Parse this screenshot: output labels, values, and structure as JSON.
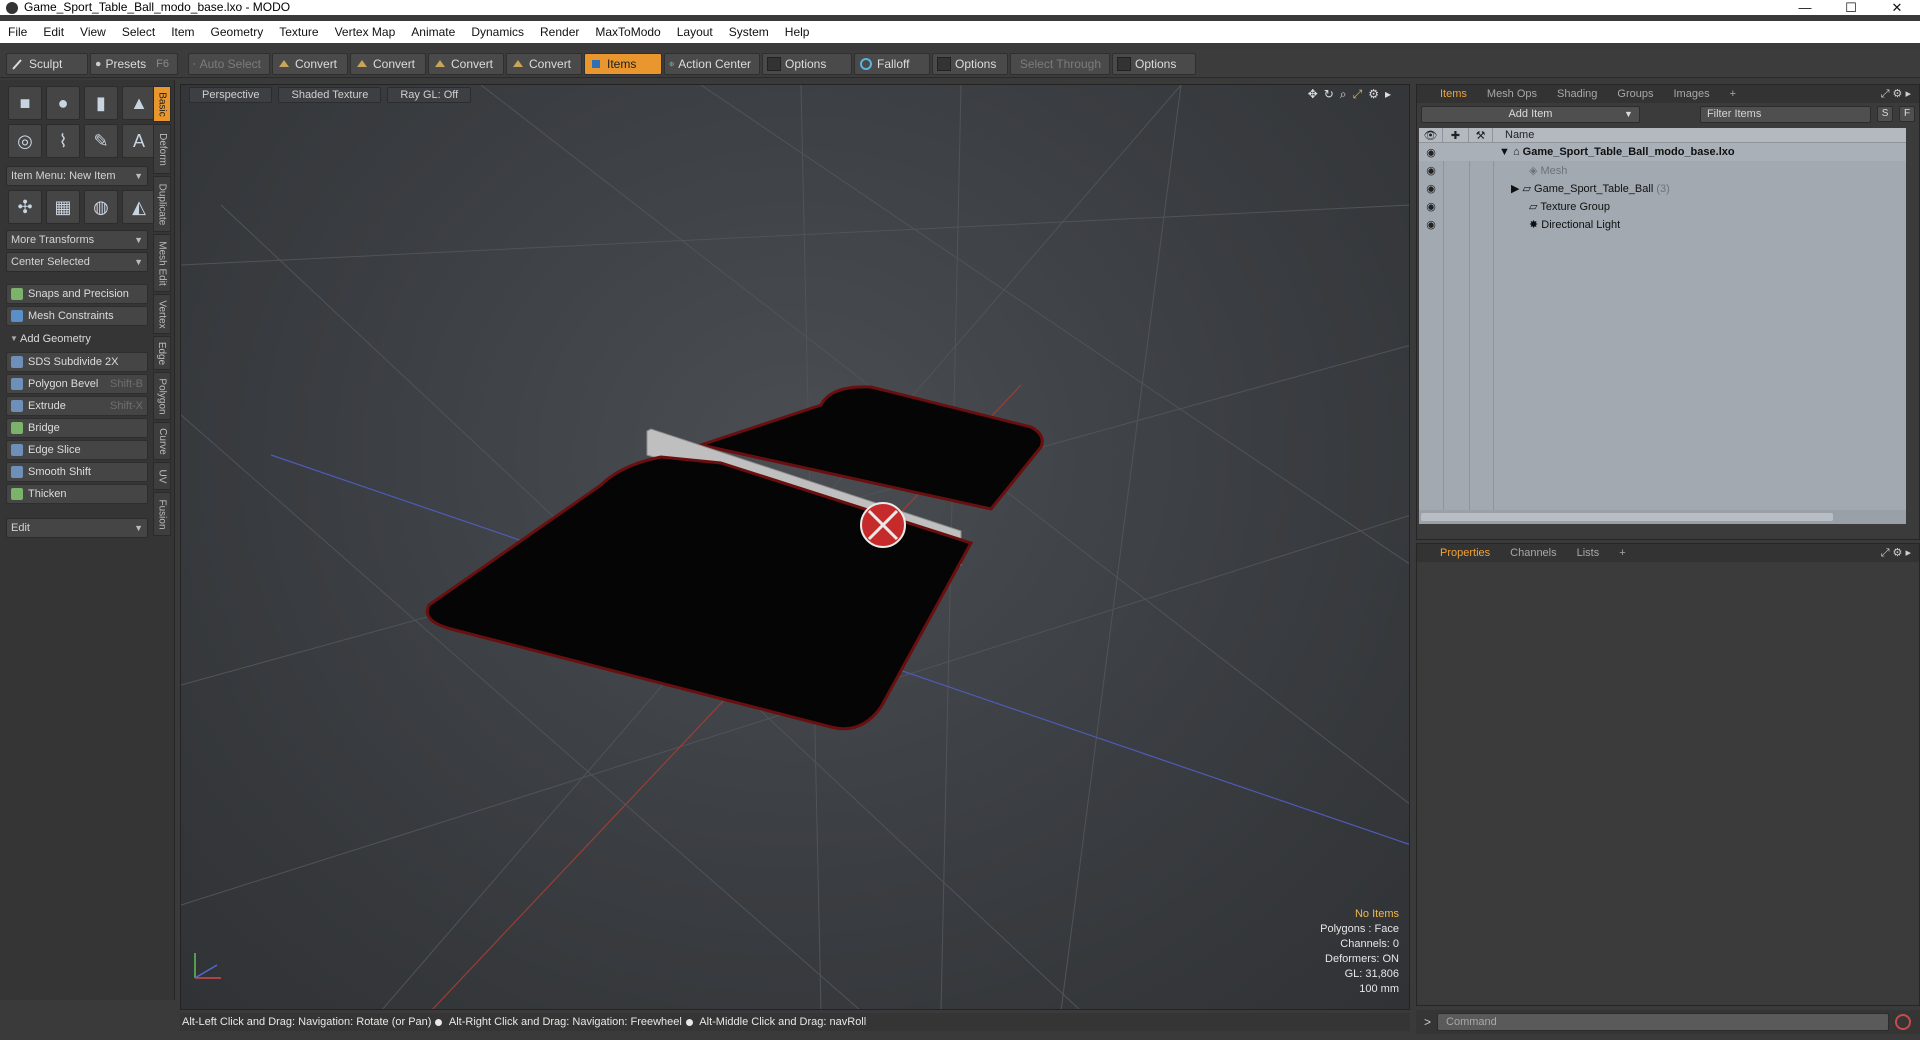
{
  "window": {
    "title": "Game_Sport_Table_Ball_modo_base.lxo - MODO",
    "min": "—",
    "max": "☐",
    "close": "✕"
  },
  "menu": [
    "File",
    "Edit",
    "View",
    "Select",
    "Item",
    "Geometry",
    "Texture",
    "Vertex Map",
    "Animate",
    "Dynamics",
    "Render",
    "MaxToModo",
    "Layout",
    "System",
    "Help"
  ],
  "toolbar": {
    "sculpt": "Sculpt",
    "presets": "Presets",
    "presets_shortcut": "F6",
    "auto_select": "Auto Select",
    "convert1": "Convert",
    "convert2": "Convert",
    "convert3": "Convert",
    "convert4": "Convert",
    "items": "Items",
    "action_center": "Action Center",
    "options1": "Options",
    "falloff": "Falloff",
    "options2": "Options",
    "select_through": "Select Through",
    "options3": "Options"
  },
  "left": {
    "item_menu": "Item Menu: New Item",
    "more_transforms": "More Transforms",
    "center_selected": "Center Selected",
    "snaps": "Snaps and Precision",
    "mesh_constraints": "Mesh Constraints",
    "add_geometry": "Add Geometry",
    "tools": [
      {
        "label": "SDS Subdivide 2X",
        "shortcut": ""
      },
      {
        "label": "Polygon Bevel",
        "shortcut": "Shift-B"
      },
      {
        "label": "Extrude",
        "shortcut": "Shift-X"
      },
      {
        "label": "Bridge",
        "shortcut": ""
      },
      {
        "label": "Edge Slice",
        "shortcut": ""
      },
      {
        "label": "Smooth Shift",
        "shortcut": ""
      },
      {
        "label": "Thicken",
        "shortcut": ""
      }
    ],
    "edit": "Edit"
  },
  "vtabs": [
    "Basic",
    "Deform",
    "Duplicate",
    "Mesh Edit",
    "Vertex",
    "Edge",
    "Polygon",
    "Curve",
    "UV",
    "Fusion"
  ],
  "viewport": {
    "perspective": "Perspective",
    "shaded": "Shaded Texture",
    "raygl": "Ray GL: Off",
    "stats": {
      "selection": "No Items",
      "polygons": "Polygons : Face",
      "channels": "Channels: 0",
      "deformers": "Deformers: ON",
      "gl": "GL: 31,806",
      "unit": "100 mm"
    },
    "colors": {
      "accent": "#f0b94a",
      "table": "#050505",
      "table_edge": "#6a0f0f",
      "net": "#bfbfbf"
    }
  },
  "hint": {
    "h1": "Alt-Left Click and Drag: Navigation: Rotate (or Pan)",
    "h2": "Alt-Right Click and Drag: Navigation: Freewheel",
    "h3": "Alt-Middle Click and Drag: navRoll"
  },
  "items_panel": {
    "tabs": [
      "Items",
      "Mesh Ops",
      "Shading",
      "Groups",
      "Images",
      "+"
    ],
    "add_item": "Add Item",
    "filter": "Filter Items",
    "s_btn": "S",
    "f_btn": "F",
    "col_name": "Name",
    "rows": [
      {
        "label": "Game_Sport_Table_Ball_modo_base.lxo",
        "count": ""
      },
      {
        "label": "Mesh",
        "count": ""
      },
      {
        "label": "Game_Sport_Table_Ball",
        "count": "(3)"
      },
      {
        "label": "Texture Group",
        "count": ""
      },
      {
        "label": "Directional Light",
        "count": ""
      }
    ]
  },
  "props_panel": {
    "tabs": [
      "Properties",
      "Channels",
      "Lists",
      "+"
    ]
  },
  "command": {
    "placeholder": "Command",
    "prompt": ">"
  }
}
